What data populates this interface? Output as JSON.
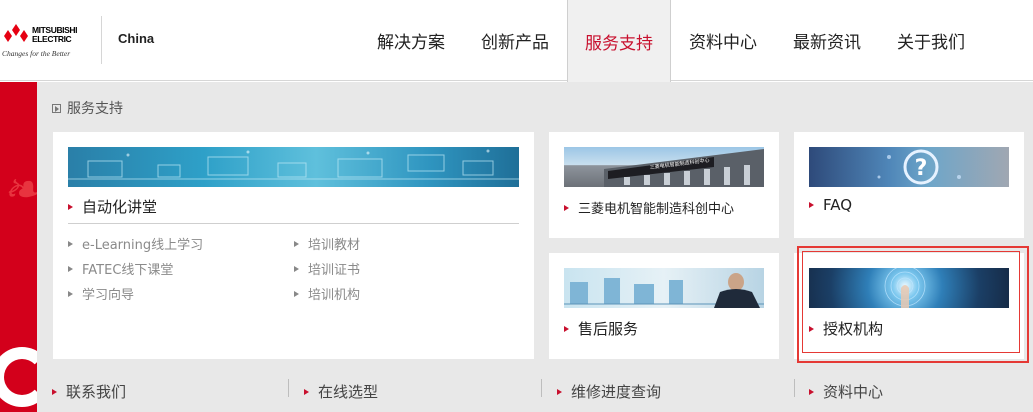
{
  "brand": {
    "wordmark_line1": "MITSUBISHI",
    "wordmark_line2": "ELECTRIC",
    "tagline": "Changes for the Better",
    "region": "China"
  },
  "nav": [
    {
      "label": "解决方案",
      "active": false
    },
    {
      "label": "创新产品",
      "active": false
    },
    {
      "label": "服务支持",
      "active": true
    },
    {
      "label": "资料中心",
      "active": false
    },
    {
      "label": "最新资讯",
      "active": false
    },
    {
      "label": "关于我们",
      "active": false
    }
  ],
  "breadcrumb": "服务支持",
  "cards": {
    "automation": {
      "title": "自动化讲堂",
      "links_left": [
        "e-Learning线上学习",
        "FATEC线下课堂",
        "学习向导"
      ],
      "links_right": [
        "培训教材",
        "培训证书",
        "培训机构"
      ]
    },
    "innovation_center": {
      "title": "三菱电机智能制造科创中心",
      "sign_text": "三菱电机智能制造科创中心"
    },
    "faq": {
      "title": "FAQ"
    },
    "after_sales": {
      "title": "售后服务"
    },
    "authorized": {
      "title": "授权机构"
    }
  },
  "footer_links": [
    "联系我们",
    "在线选型",
    "维修进度查询",
    "资料中心"
  ],
  "colors": {
    "accent_red": "#c8102e",
    "side_red": "#d3001b",
    "highlight": "#e53935",
    "page_bg": "#e8e8e8"
  }
}
